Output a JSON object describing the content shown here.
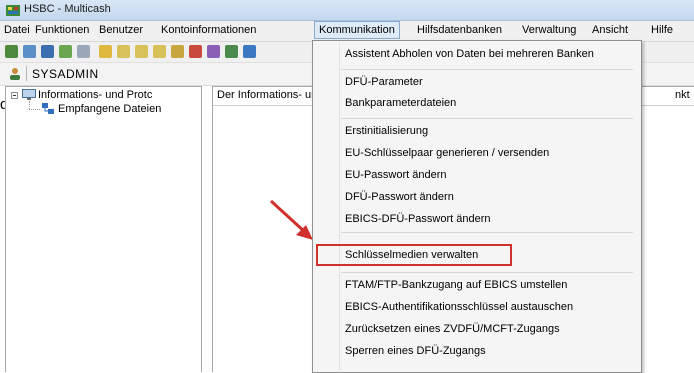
{
  "window": {
    "title": "HSBC - Multicash"
  },
  "menubar": {
    "items": [
      {
        "label": "Datei"
      },
      {
        "label": "Funktionen"
      },
      {
        "label": "Benutzer"
      },
      {
        "label": "Kontoinformationen"
      },
      {
        "label": "Kommunikation"
      },
      {
        "label": "Hilfsdatenbanken"
      },
      {
        "label": "Verwaltung"
      },
      {
        "label": "Ansicht"
      },
      {
        "label": "Hilfe"
      }
    ]
  },
  "stray_text": "d",
  "profile": {
    "name": "SYSADMIN"
  },
  "tree": {
    "root_label": "Informations- und Protc",
    "child_label": "Empfangene Dateien"
  },
  "content": {
    "col1_header": "Der Informations- un",
    "right_clipped": "nkt"
  },
  "dropdown": {
    "items": [
      {
        "label": "Assistent Abholen von Daten bei mehreren Banken"
      },
      {
        "label": "DFÜ-Parameter"
      },
      {
        "label": "Bankparameterdateien"
      },
      {
        "label": "Erstinitialisierung"
      },
      {
        "label": "EU-Schlüsselpaar generieren / versenden"
      },
      {
        "label": "EU-Passwort ändern"
      },
      {
        "label": "DFÜ-Passwort ändern"
      },
      {
        "label": "EBICS-DFÜ-Passwort ändern"
      },
      {
        "label": "Schlüsselmedien verwalten"
      },
      {
        "label": "FTAM/FTP-Bankzugang auf EBICS umstellen"
      },
      {
        "label": "EBICS-Authentifikationsschlüssel austauschen"
      },
      {
        "label": "Zurücksetzen eines ZVDFÜ/MCFT-Zugangs"
      },
      {
        "label": "Sperren eines DFÜ-Zugangs"
      }
    ],
    "highlighted_index": 8
  },
  "colors": {
    "highlight_border": "#d0312d",
    "arrow": "#d0312d",
    "menu_active_bg": "#dfeaf7"
  }
}
